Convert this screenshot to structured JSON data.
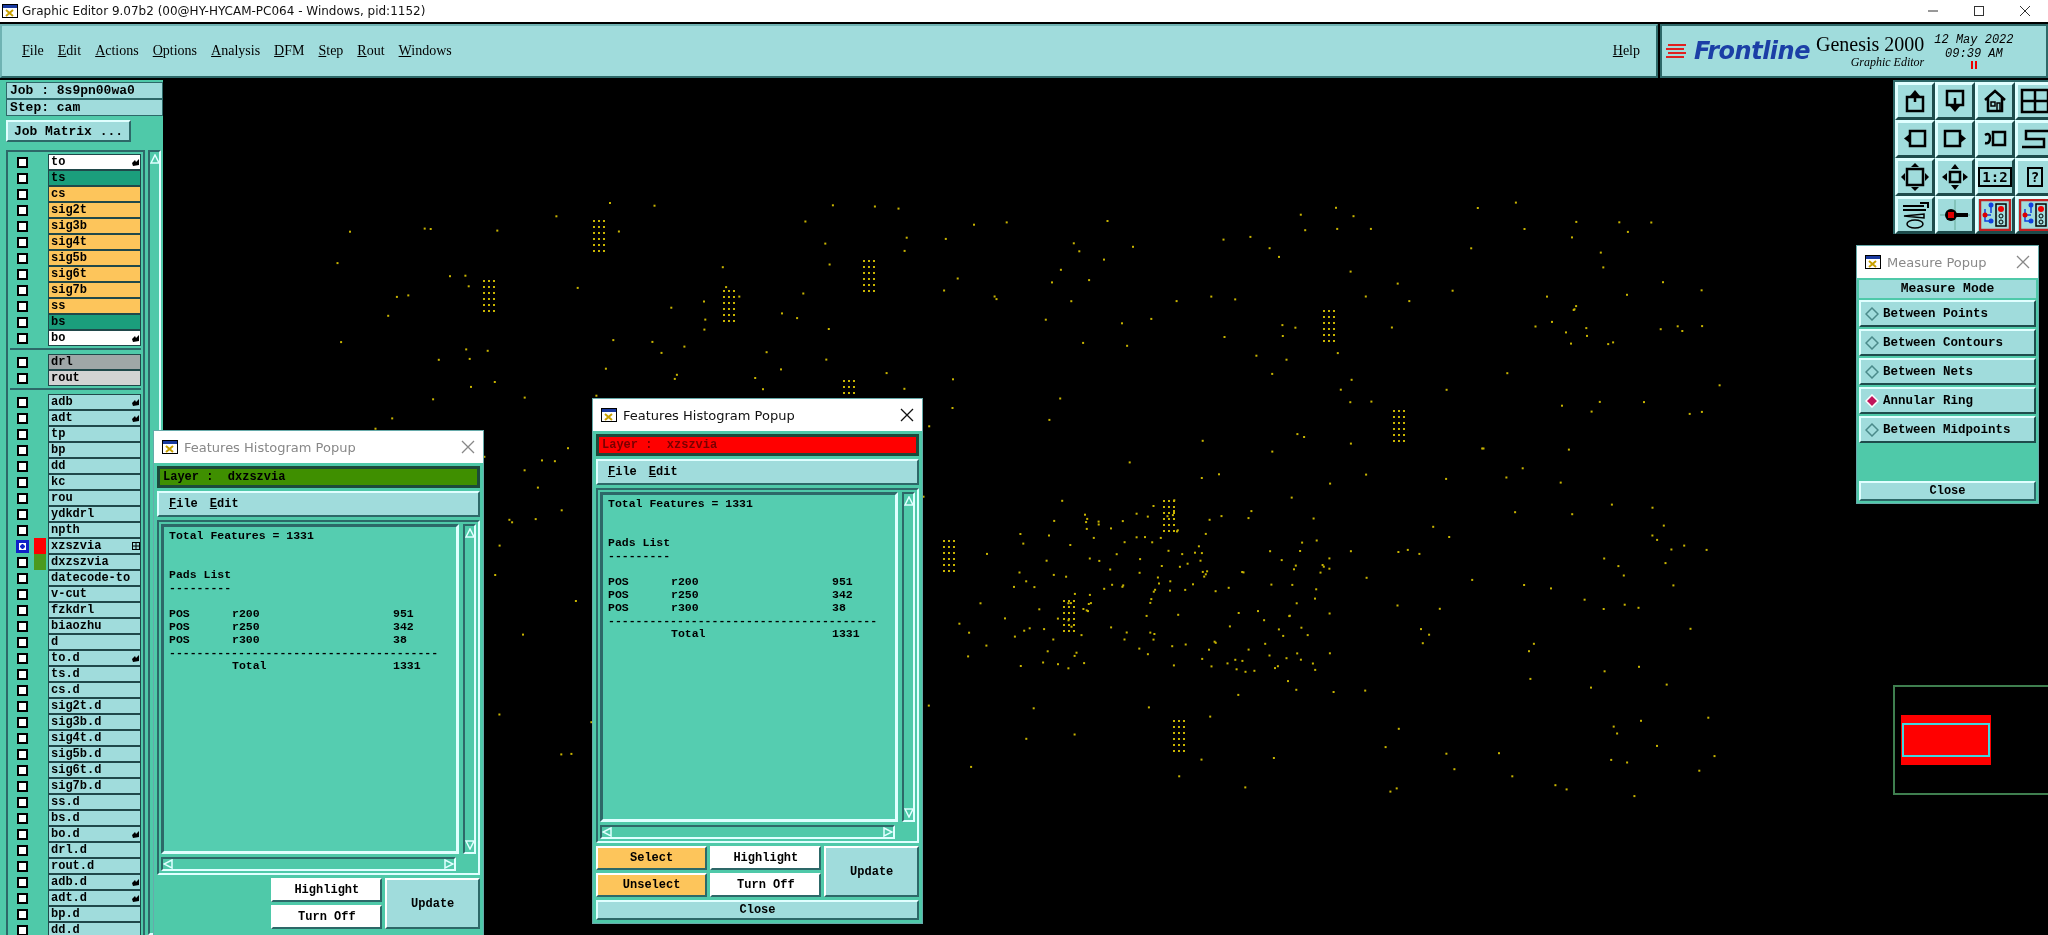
{
  "window": {
    "title": "Graphic Editor 9.07b2 (00@HY-HYCAM-PC064 - Windows, pid:1152)"
  },
  "menu": [
    "File",
    "Edit",
    "Actions",
    "Options",
    "Analysis",
    "DFM",
    "Step",
    "Rout",
    "Windows"
  ],
  "help": "Help",
  "logo": {
    "brand": "Frontline",
    "product": "Genesis 2000",
    "subtitle": "Graphic Editor",
    "date": "12 May 2022",
    "time": "09:39 AM"
  },
  "job": {
    "job": "Job : 8s9pn00wa0",
    "step": "Step: cam",
    "matrix_button": "Job Matrix ..."
  },
  "layer_groups": [
    [
      {
        "name": "to",
        "color": "#ffffff",
        "flagged": true,
        "active": false
      },
      {
        "name": "ts",
        "color": "#1b9e7c",
        "flagged": false,
        "active": false
      },
      {
        "name": "cs",
        "color": "#fdc55b",
        "flagged": false,
        "active": false
      },
      {
        "name": "sig2t",
        "color": "#fdc55b",
        "flagged": false,
        "active": false
      },
      {
        "name": "sig3b",
        "color": "#fdc55b",
        "flagged": false,
        "active": false
      },
      {
        "name": "sig4t",
        "color": "#fdc55b",
        "flagged": false,
        "active": false
      },
      {
        "name": "sig5b",
        "color": "#fdc55b",
        "flagged": false,
        "active": false
      },
      {
        "name": "sig6t",
        "color": "#fdc55b",
        "flagged": false,
        "active": false
      },
      {
        "name": "sig7b",
        "color": "#fdc55b",
        "flagged": false,
        "active": false
      },
      {
        "name": "ss",
        "color": "#fdc55b",
        "flagged": false,
        "active": false
      },
      {
        "name": "bs",
        "color": "#1b9e7c",
        "flagged": false,
        "active": false
      },
      {
        "name": "bo",
        "color": "#ffffff",
        "flagged": true,
        "active": false
      }
    ],
    [
      {
        "name": "drl",
        "color": "#9fa7a7",
        "flagged": false,
        "active": false
      },
      {
        "name": "rout",
        "color": "#d3d3d3",
        "flagged": false,
        "active": false
      }
    ],
    [
      {
        "name": "adb",
        "color": "#a0dcdc",
        "flagged": true,
        "active": false
      },
      {
        "name": "adt",
        "color": "#a0dcdc",
        "flagged": true,
        "active": false
      },
      {
        "name": "tp",
        "color": "#a0dcdc",
        "flagged": false,
        "active": false
      },
      {
        "name": "bp",
        "color": "#a0dcdc",
        "flagged": false,
        "active": false
      },
      {
        "name": "dd",
        "color": "#a0dcdc",
        "flagged": false,
        "active": false
      },
      {
        "name": "kc",
        "color": "#a0dcdc",
        "flagged": false,
        "active": false
      },
      {
        "name": "rou",
        "color": "#a0dcdc",
        "flagged": false,
        "active": false
      },
      {
        "name": "ydkdrl",
        "color": "#a0dcdc",
        "flagged": false,
        "active": false
      },
      {
        "name": "npth",
        "color": "#a0dcdc",
        "flagged": false,
        "active": false
      },
      {
        "name": "xzszvia",
        "color": "#a0dcdc",
        "flagged": false,
        "active": true,
        "swatch": {
          "color": "#ff0000"
        }
      },
      {
        "name": "dxzszvia",
        "color": "#a0dcdc",
        "flagged": false,
        "active": false,
        "swatch": {
          "color": "#4b9a1e"
        }
      },
      {
        "name": "datecode-to",
        "color": "#a0dcdc",
        "flagged": false,
        "active": false
      },
      {
        "name": "v-cut",
        "color": "#a0dcdc",
        "flagged": false,
        "active": false
      },
      {
        "name": "fzkdrl",
        "color": "#a0dcdc",
        "flagged": false,
        "active": false
      },
      {
        "name": "biaozhu",
        "color": "#a0dcdc",
        "flagged": false,
        "active": false
      },
      {
        "name": "d",
        "color": "#a0dcdc",
        "flagged": false,
        "active": false
      },
      {
        "name": "to.d",
        "color": "#a0dcdc",
        "flagged": true,
        "active": false
      },
      {
        "name": "ts.d",
        "color": "#a0dcdc",
        "flagged": false,
        "active": false
      },
      {
        "name": "cs.d",
        "color": "#a0dcdc",
        "flagged": false,
        "active": false
      },
      {
        "name": "sig2t.d",
        "color": "#a0dcdc",
        "flagged": false,
        "active": false
      },
      {
        "name": "sig3b.d",
        "color": "#a0dcdc",
        "flagged": false,
        "active": false
      },
      {
        "name": "sig4t.d",
        "color": "#a0dcdc",
        "flagged": false,
        "active": false
      },
      {
        "name": "sig5b.d",
        "color": "#a0dcdc",
        "flagged": false,
        "active": false
      },
      {
        "name": "sig6t.d",
        "color": "#a0dcdc",
        "flagged": false,
        "active": false
      },
      {
        "name": "sig7b.d",
        "color": "#a0dcdc",
        "flagged": false,
        "active": false
      },
      {
        "name": "ss.d",
        "color": "#a0dcdc",
        "flagged": false,
        "active": false
      },
      {
        "name": "bs.d",
        "color": "#a0dcdc",
        "flagged": false,
        "active": false
      },
      {
        "name": "bo.d",
        "color": "#a0dcdc",
        "flagged": true,
        "active": false
      },
      {
        "name": "drl.d",
        "color": "#a0dcdc",
        "flagged": false,
        "active": false
      },
      {
        "name": "rout.d",
        "color": "#a0dcdc",
        "flagged": false,
        "active": false
      },
      {
        "name": "adb.d",
        "color": "#a0dcdc",
        "flagged": true,
        "active": false
      },
      {
        "name": "adt.d",
        "color": "#a0dcdc",
        "flagged": true,
        "active": false
      },
      {
        "name": "bp.d",
        "color": "#a0dcdc",
        "flagged": false,
        "active": false
      },
      {
        "name": "dd.d",
        "color": "#a0dcdc",
        "flagged": false,
        "active": false
      }
    ]
  ],
  "toolbar": [
    {
      "kind": "export"
    },
    {
      "kind": "import"
    },
    {
      "kind": "home"
    },
    {
      "kind": "grid"
    },
    {
      "kind": "left"
    },
    {
      "kind": "right"
    },
    {
      "kind": "undo"
    },
    {
      "kind": "snake"
    },
    {
      "kind": "fit"
    },
    {
      "kind": "center"
    },
    {
      "kind": "text",
      "label": "1:2"
    },
    {
      "kind": "text",
      "label": "?"
    },
    {
      "kind": "tools"
    },
    {
      "kind": "probe"
    },
    {
      "kind": "circuit"
    },
    {
      "kind": "circuit"
    }
  ],
  "popups": [
    {
      "title": "Features Histogram Popup",
      "focused": false,
      "layer": {
        "label": "Layer :  dxzszvia",
        "color": "#3f8f00"
      },
      "menu": [
        "File",
        "Edit"
      ],
      "total": "Total Features = 1331",
      "section": "Pads List",
      "underline": "---------",
      "rows": [
        {
          "type": "POS",
          "symbol": "r200",
          "count": "951"
        },
        {
          "type": "POS",
          "symbol": "r250",
          "count": "342"
        },
        {
          "type": "POS",
          "symbol": "r300",
          "count": "38"
        }
      ],
      "separator": "---------------------------------------",
      "total_row": {
        "label": "Total",
        "count": "1331"
      },
      "toggle_buttons": [
        "Highlight",
        "Turn Off"
      ],
      "update_button": "Update"
    },
    {
      "title": "Features Histogram Popup",
      "focused": true,
      "layer": {
        "label": "Layer :  xzszvia",
        "color": "#ff0000"
      },
      "menu": [
        "File",
        "Edit"
      ],
      "total": "Total Features = 1331",
      "section": "Pads List",
      "underline": "---------",
      "rows": [
        {
          "type": "POS",
          "symbol": "r200",
          "count": "951"
        },
        {
          "type": "POS",
          "symbol": "r250",
          "count": "342"
        },
        {
          "type": "POS",
          "symbol": "r300",
          "count": "38"
        }
      ],
      "separator": "---------------------------------------",
      "total_row": {
        "label": "Total",
        "count": "1331"
      },
      "select_buttons": [
        "Select",
        "Unselect"
      ],
      "toggle_buttons": [
        "Highlight",
        "Turn Off"
      ],
      "update_button": "Update",
      "close_button": "Close"
    }
  ],
  "measure": {
    "title": "Measure Popup",
    "focused": false,
    "heading": "Measure Mode",
    "options": [
      {
        "label": "Between Points",
        "selected": false
      },
      {
        "label": "Between Contours",
        "selected": false
      },
      {
        "label": "Between Nets",
        "selected": false
      },
      {
        "label": "Annular Ring",
        "selected": true
      },
      {
        "label": "Between Midpoints",
        "selected": false
      }
    ],
    "close_button": "Close"
  }
}
